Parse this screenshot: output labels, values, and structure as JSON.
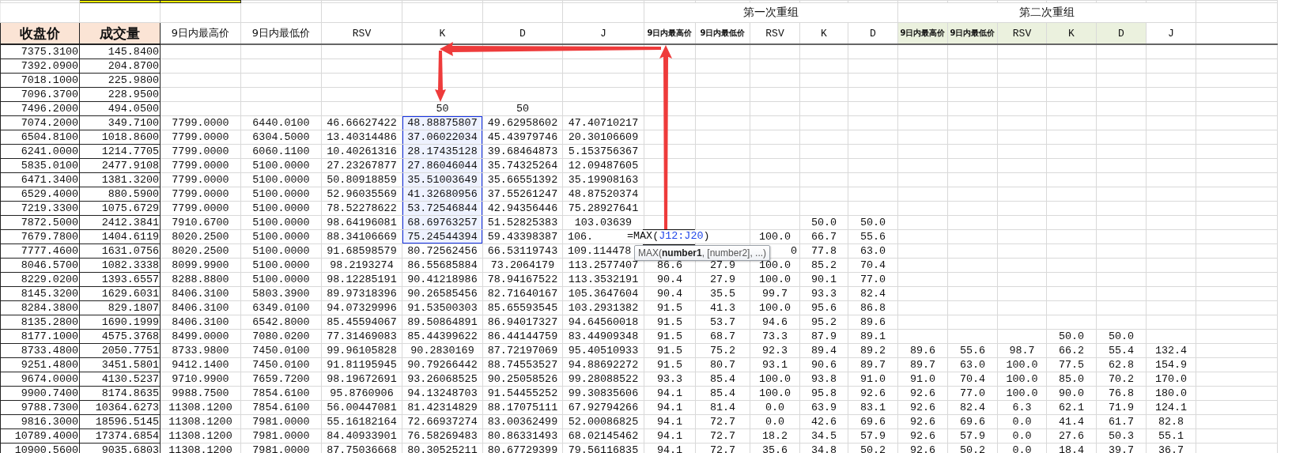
{
  "sheet": {
    "base_columns": [
      {
        "label": "收盘价",
        "kind": "key"
      },
      {
        "label": "成交量",
        "kind": "key"
      },
      {
        "label": "9日内最高价",
        "kind": "plain"
      },
      {
        "label": "9日内最低价",
        "kind": "plain"
      },
      {
        "label": "RSV",
        "kind": "mono"
      },
      {
        "label": "K",
        "kind": "mono"
      },
      {
        "label": "D",
        "kind": "mono"
      },
      {
        "label": "J",
        "kind": "mono"
      }
    ],
    "groups": [
      {
        "title": "第一次重组",
        "columns": [
          {
            "label": "9日内最高价",
            "kind": "small"
          },
          {
            "label": "9日内最低价",
            "kind": "small"
          },
          {
            "label": "RSV",
            "kind": "mono"
          },
          {
            "label": "K",
            "kind": "mono"
          },
          {
            "label": "D",
            "kind": "mono"
          }
        ]
      },
      {
        "title": "第二次重组",
        "columns": [
          {
            "label": "9日内最高价",
            "kind": "small_tinted"
          },
          {
            "label": "9日内最低价",
            "kind": "small_tinted"
          },
          {
            "label": "RSV",
            "kind": "mono_tinted"
          },
          {
            "label": "K",
            "kind": "mono_tinted"
          },
          {
            "label": "D",
            "kind": "mono_tinted"
          },
          {
            "label": "J",
            "kind": "mono"
          }
        ]
      }
    ],
    "rows": [
      {
        "k_selected": false,
        "cells": [
          "7375.3100",
          "145.8400"
        ]
      },
      {
        "k_selected": false,
        "cells": [
          "7392.0900",
          "204.8700"
        ]
      },
      {
        "k_selected": false,
        "cells": [
          "7018.1000",
          "225.9800"
        ]
      },
      {
        "k_selected": false,
        "cells": [
          "7096.3700",
          "228.9500"
        ]
      },
      {
        "k_selected": false,
        "cells": [
          "7496.2000",
          "494.0500",
          null,
          null,
          null,
          "50",
          "50"
        ]
      },
      {
        "k_selected": true,
        "cells": [
          "7074.2000",
          "349.7100",
          "7799.0000",
          "6440.0100",
          "46.66627422",
          "48.88875807",
          "49.62958602",
          "47.40710217"
        ]
      },
      {
        "k_selected": true,
        "cells": [
          "6504.8100",
          "1018.8600",
          "7799.0000",
          "6304.5000",
          "13.40314486",
          "37.06022034",
          "45.43979746",
          "20.30106609"
        ]
      },
      {
        "k_selected": true,
        "cells": [
          "6241.0000",
          "1214.7705",
          "7799.0000",
          "6060.1100",
          "10.40261316",
          "28.17435128",
          "39.68464873",
          "5.153756367"
        ]
      },
      {
        "k_selected": true,
        "cells": [
          "5835.0100",
          "2477.9108",
          "7799.0000",
          "5100.0000",
          "27.23267877",
          "27.86046044",
          "35.74325264",
          "12.09487605"
        ]
      },
      {
        "k_selected": true,
        "cells": [
          "6471.3400",
          "1381.3200",
          "7799.0000",
          "5100.0000",
          "50.80918859",
          "35.51003649",
          "35.66551392",
          "35.19908163"
        ]
      },
      {
        "k_selected": true,
        "cells": [
          "6529.4000",
          "880.5900",
          "7799.0000",
          "5100.0000",
          "52.96035569",
          "41.32680956",
          "37.55261247",
          "48.87520374"
        ]
      },
      {
        "k_selected": true,
        "cells": [
          "7219.3300",
          "1075.6729",
          "7799.0000",
          "5100.0000",
          "78.52278622",
          "53.72546844",
          "42.94356446",
          "75.28927641"
        ]
      },
      {
        "k_selected": true,
        "cells": [
          "7872.5000",
          "2412.3841",
          "7910.6700",
          "5100.0000",
          "98.64196081",
          "68.69763257",
          "51.52825383",
          "103.03639",
          null,
          null,
          null,
          "50.0",
          "50.0"
        ]
      },
      {
        "k_selected": true,
        "cells": [
          "7679.7800",
          "1404.6119",
          "8020.2500",
          "5100.0000",
          "88.34106669",
          "75.24544394",
          "59.43398387",
          {
            "text": "106.",
            "kind": "cut"
          },
          null,
          null,
          "100.0",
          "66.7",
          "55.6"
        ],
        "editor": [
          {
            "text": "=MAX(",
            "kind": "plain"
          },
          {
            "text": "J12",
            "kind": "ref"
          },
          {
            "text": ":",
            "kind": "ref"
          },
          {
            "text": "J20",
            "kind": "ref"
          },
          {
            "text": ")",
            "kind": "plain"
          }
        ]
      },
      {
        "k_selected": false,
        "cells": [
          "7777.4600",
          "1631.0756",
          "8020.2500",
          "5100.0000",
          "91.68598579",
          "80.72562456",
          "66.53119743",
          {
            "text": "109.114478",
            "kind": "cut"
          },
          null,
          null,
          {
            "text": "0",
            "kind": "peek"
          },
          "77.8",
          "63.0"
        ],
        "tooltip": "MAX(**number1**, [number2], ...)"
      },
      {
        "k_selected": false,
        "cells": [
          "8046.5700",
          "1082.3338",
          "8099.9900",
          "5100.0000",
          "98.2193274",
          "86.55685884",
          "73.2064179",
          "113.2577407",
          "86.6",
          "27.9",
          "100.0",
          "85.2",
          "70.4"
        ]
      },
      {
        "k_selected": false,
        "cells": [
          "8229.0200",
          "1393.6557",
          "8288.8800",
          "5100.0000",
          "98.12285191",
          "90.41218986",
          "78.94167522",
          "113.3532191",
          "90.4",
          "27.9",
          "100.0",
          "90.1",
          "77.0"
        ]
      },
      {
        "k_selected": false,
        "cells": [
          "8145.3200",
          "1629.6031",
          "8406.3100",
          "5803.3900",
          "89.97318396",
          "90.26585456",
          "82.71640167",
          "105.3647604",
          "90.4",
          "35.5",
          "99.7",
          "93.3",
          "82.4"
        ]
      },
      {
        "k_selected": false,
        "cells": [
          "8284.3800",
          "829.1807",
          "8406.3100",
          "6349.0100",
          "94.07329996",
          "91.53500303",
          "85.65593545",
          "103.2931382",
          "91.5",
          "41.3",
          "100.0",
          "95.6",
          "86.8"
        ]
      },
      {
        "k_selected": false,
        "cells": [
          "8135.2800",
          "1690.1999",
          "8406.3100",
          "6542.8000",
          "85.45594067",
          "89.50864891",
          "86.94017327",
          "94.64560018",
          "91.5",
          "53.7",
          "94.6",
          "95.2",
          "89.6"
        ]
      },
      {
        "k_selected": false,
        "cells": [
          "8177.1000",
          "4575.3768",
          "8499.0000",
          "7080.0200",
          "77.31469083",
          "85.44399622",
          "86.44144759",
          "83.44909348",
          "91.5",
          "68.7",
          "73.3",
          "87.9",
          "89.1",
          null,
          null,
          null,
          "50.0",
          "50.0"
        ]
      },
      {
        "k_selected": false,
        "cells": [
          "8733.4800",
          "2050.7751",
          "8733.9800",
          "7450.0100",
          "99.96105828",
          "90.2830169",
          "87.72197069",
          "95.40510933",
          "91.5",
          "75.2",
          "92.3",
          "89.4",
          "89.2",
          "89.6",
          "55.6",
          "98.7",
          "66.2",
          "55.4",
          "132.4"
        ]
      },
      {
        "k_selected": false,
        "cells": [
          "9251.4800",
          "3451.5801",
          "9412.1400",
          "7450.0100",
          "91.81195945",
          "90.79266442",
          "88.74553527",
          "94.88692272",
          "91.5",
          "80.7",
          "93.1",
          "90.6",
          "89.7",
          "89.7",
          "63.0",
          "100.0",
          "77.5",
          "62.8",
          "154.9"
        ]
      },
      {
        "k_selected": false,
        "cells": [
          "9674.0000",
          "4130.5237",
          "9710.9900",
          "7659.7200",
          "98.19672691",
          "93.26068525",
          "90.25058526",
          "99.28088522",
          "93.3",
          "85.4",
          "100.0",
          "93.8",
          "91.0",
          "91.0",
          "70.4",
          "100.0",
          "85.0",
          "70.2",
          "170.0"
        ]
      },
      {
        "k_selected": false,
        "cells": [
          "9900.7400",
          "8174.8635",
          "9988.7500",
          "7854.6100",
          "95.8760906",
          "94.13248703",
          "91.54455252",
          "99.30835606",
          "94.1",
          "85.4",
          "100.0",
          "95.8",
          "92.6",
          "92.6",
          "77.0",
          "100.0",
          "90.0",
          "76.8",
          "180.0"
        ]
      },
      {
        "k_selected": false,
        "cells": [
          "9788.7300",
          "10364.6273",
          "11308.1200",
          "7854.6100",
          "56.00447081",
          "81.42314829",
          "88.17075111",
          "67.92794266",
          "94.1",
          "81.4",
          "0.0",
          "63.9",
          "83.1",
          "92.6",
          "82.4",
          "6.3",
          "62.1",
          "71.9",
          "124.1"
        ]
      },
      {
        "k_selected": false,
        "cells": [
          "9816.3000",
          "18596.5145",
          "11308.1200",
          "7981.0000",
          "55.16182164",
          "72.66937274",
          "83.00362499",
          "52.00086825",
          "94.1",
          "72.7",
          "0.0",
          "42.6",
          "69.6",
          "92.6",
          "69.6",
          "0.0",
          "41.4",
          "61.7",
          "82.8"
        ]
      },
      {
        "k_selected": false,
        "cells": [
          "10789.4000",
          "17374.6854",
          "11308.1200",
          "7981.0000",
          "84.40933901",
          "76.58269483",
          "80.86331493",
          "68.02145462",
          "94.1",
          "72.7",
          "18.2",
          "34.5",
          "57.9",
          "92.6",
          "57.9",
          "0.0",
          "27.6",
          "50.3",
          "55.1"
        ]
      },
      {
        "k_selected": false,
        "cells": [
          "10900.5600",
          "9035.6803",
          "11308.1200",
          "7981.0000",
          "87.75036668",
          "80.30525211",
          "80.67729399",
          "79.56116835",
          "94.1",
          "72.7",
          "35.6",
          "34.8",
          "50.2",
          "92.6",
          "50.2",
          "0.0",
          "18.4",
          "39.7",
          "36.7"
        ]
      }
    ]
  }
}
